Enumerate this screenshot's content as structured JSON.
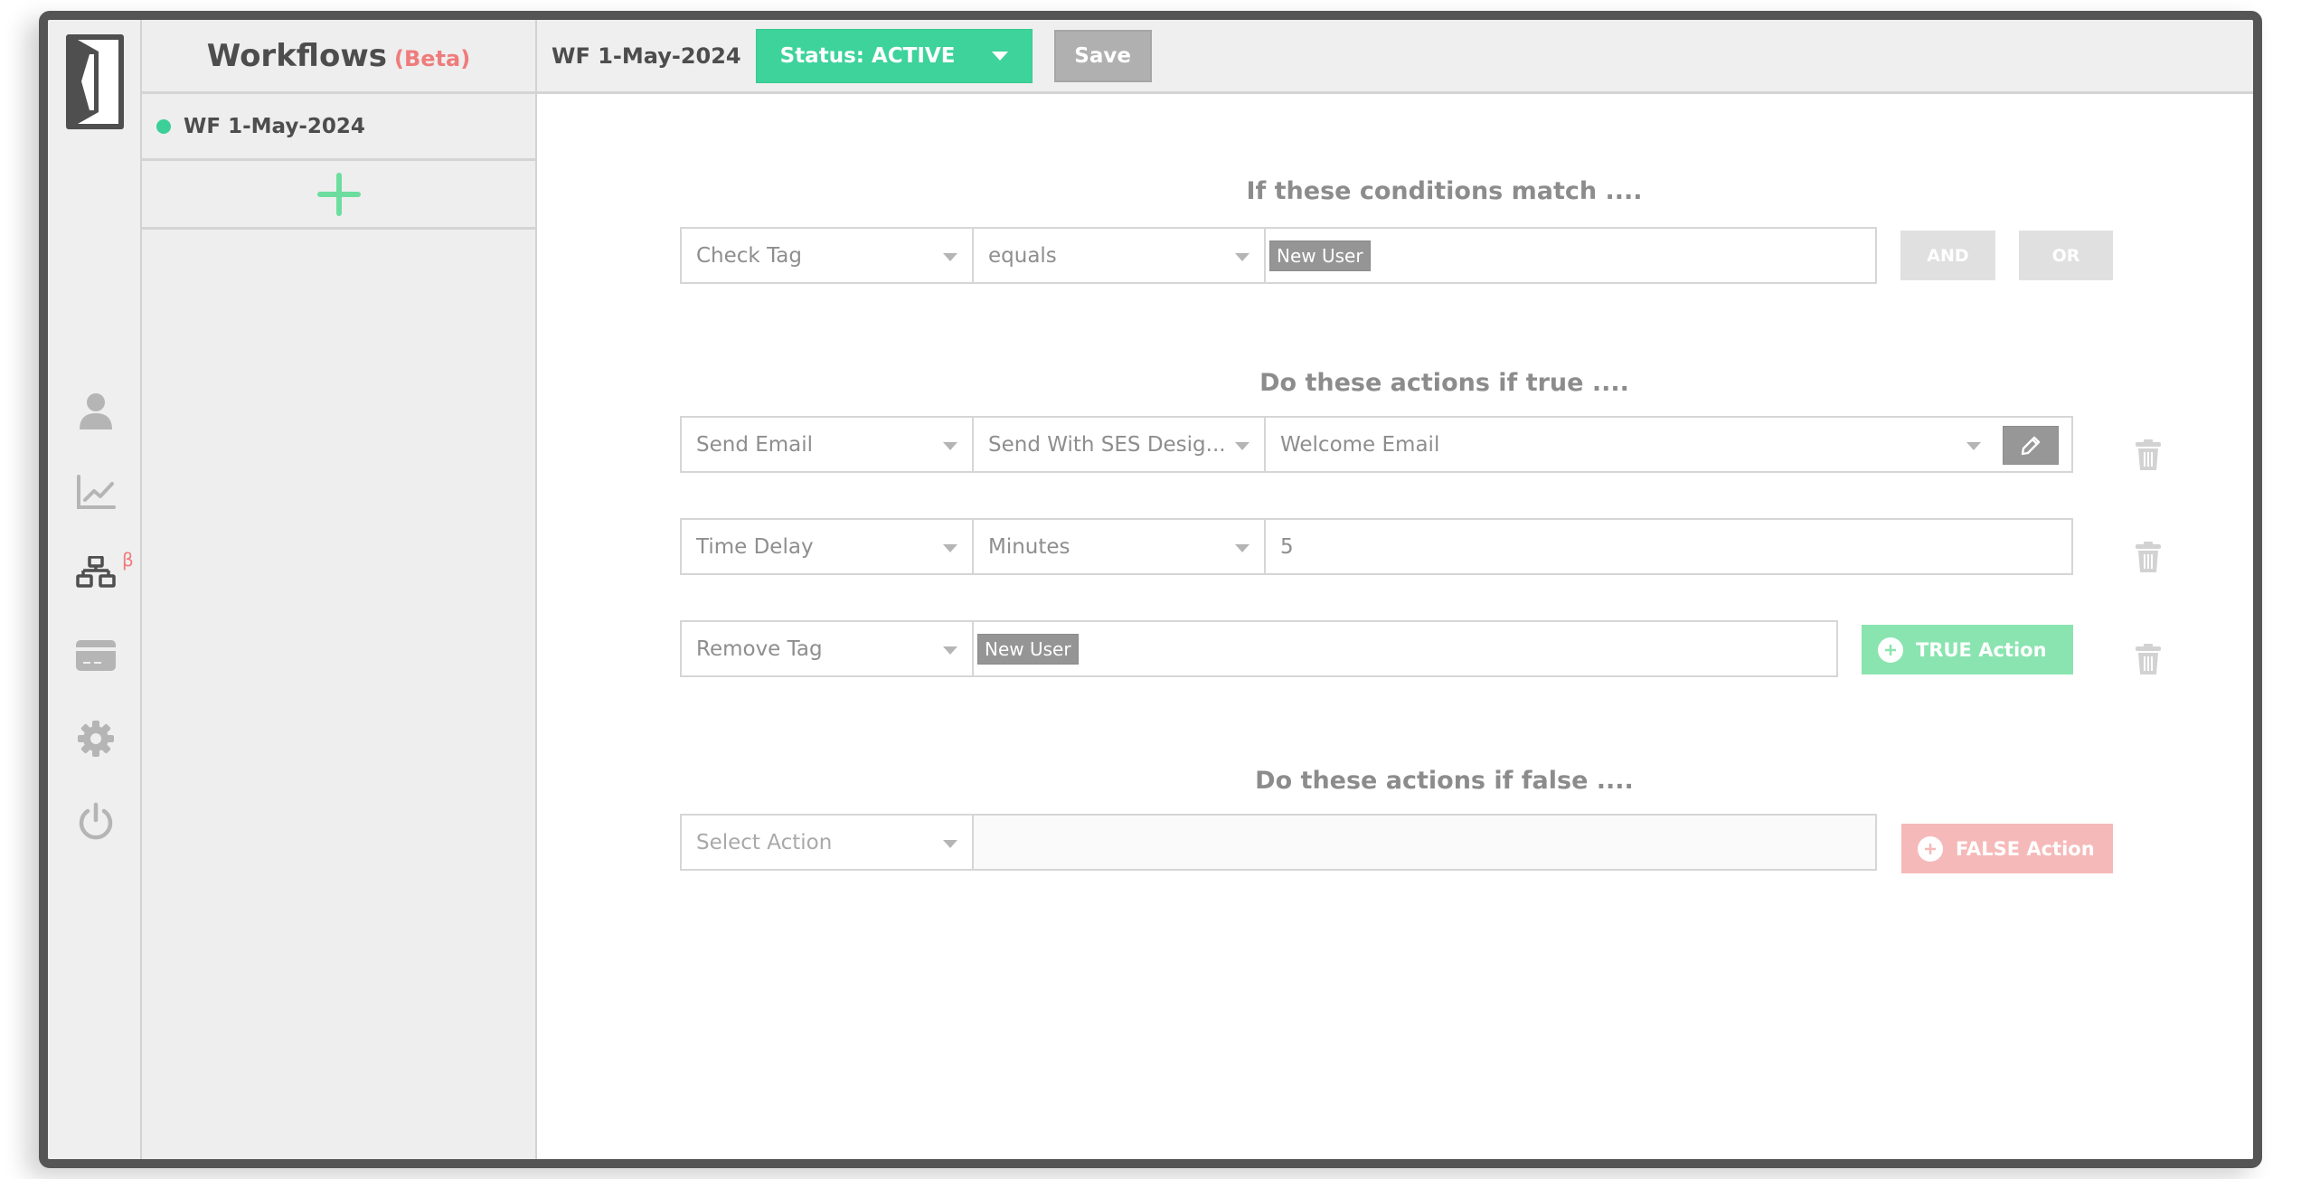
{
  "colors": {
    "accent_green": "#3dd39b",
    "beta_red": "#ef7c7c",
    "true_action_bg": "#8ae4b0",
    "false_action_bg": "#f6b9b9",
    "frame": "#555555"
  },
  "rail": {
    "icons": [
      {
        "name": "user-icon",
        "active": false
      },
      {
        "name": "chart-icon",
        "active": false
      },
      {
        "name": "workflow-icon",
        "active": true,
        "badge": "β"
      },
      {
        "name": "credit-card-icon",
        "active": false
      },
      {
        "name": "gear-icon",
        "active": false
      },
      {
        "name": "power-icon",
        "active": false
      }
    ]
  },
  "panel": {
    "title": "Workflows",
    "beta_label": "(Beta)",
    "workflows": [
      {
        "name": "WF 1-May-2024",
        "status": "active"
      }
    ],
    "add_icon": "plus-icon"
  },
  "header": {
    "title": "WF 1-May-2024",
    "status_label": "Status: ACTIVE",
    "save_label": "Save"
  },
  "conditions": {
    "heading": "If these conditions match ....",
    "row": {
      "field": "Check Tag",
      "operator": "equals",
      "tags": [
        "New User"
      ]
    },
    "and_label": "AND",
    "or_label": "OR"
  },
  "true_actions": {
    "heading": "Do these actions if true ....",
    "rows": [
      {
        "action": "Send Email",
        "method": "Send With SES Desig...",
        "value": "Welcome Email"
      },
      {
        "action": "Time Delay",
        "unit": "Minutes",
        "value": "5"
      },
      {
        "action": "Remove Tag",
        "tags": [
          "New User"
        ]
      }
    ],
    "add_label": "TRUE Action"
  },
  "false_actions": {
    "heading": "Do these actions if false ....",
    "row": {
      "action_placeholder": "Select Action",
      "value": ""
    },
    "add_label": "FALSE Action"
  }
}
